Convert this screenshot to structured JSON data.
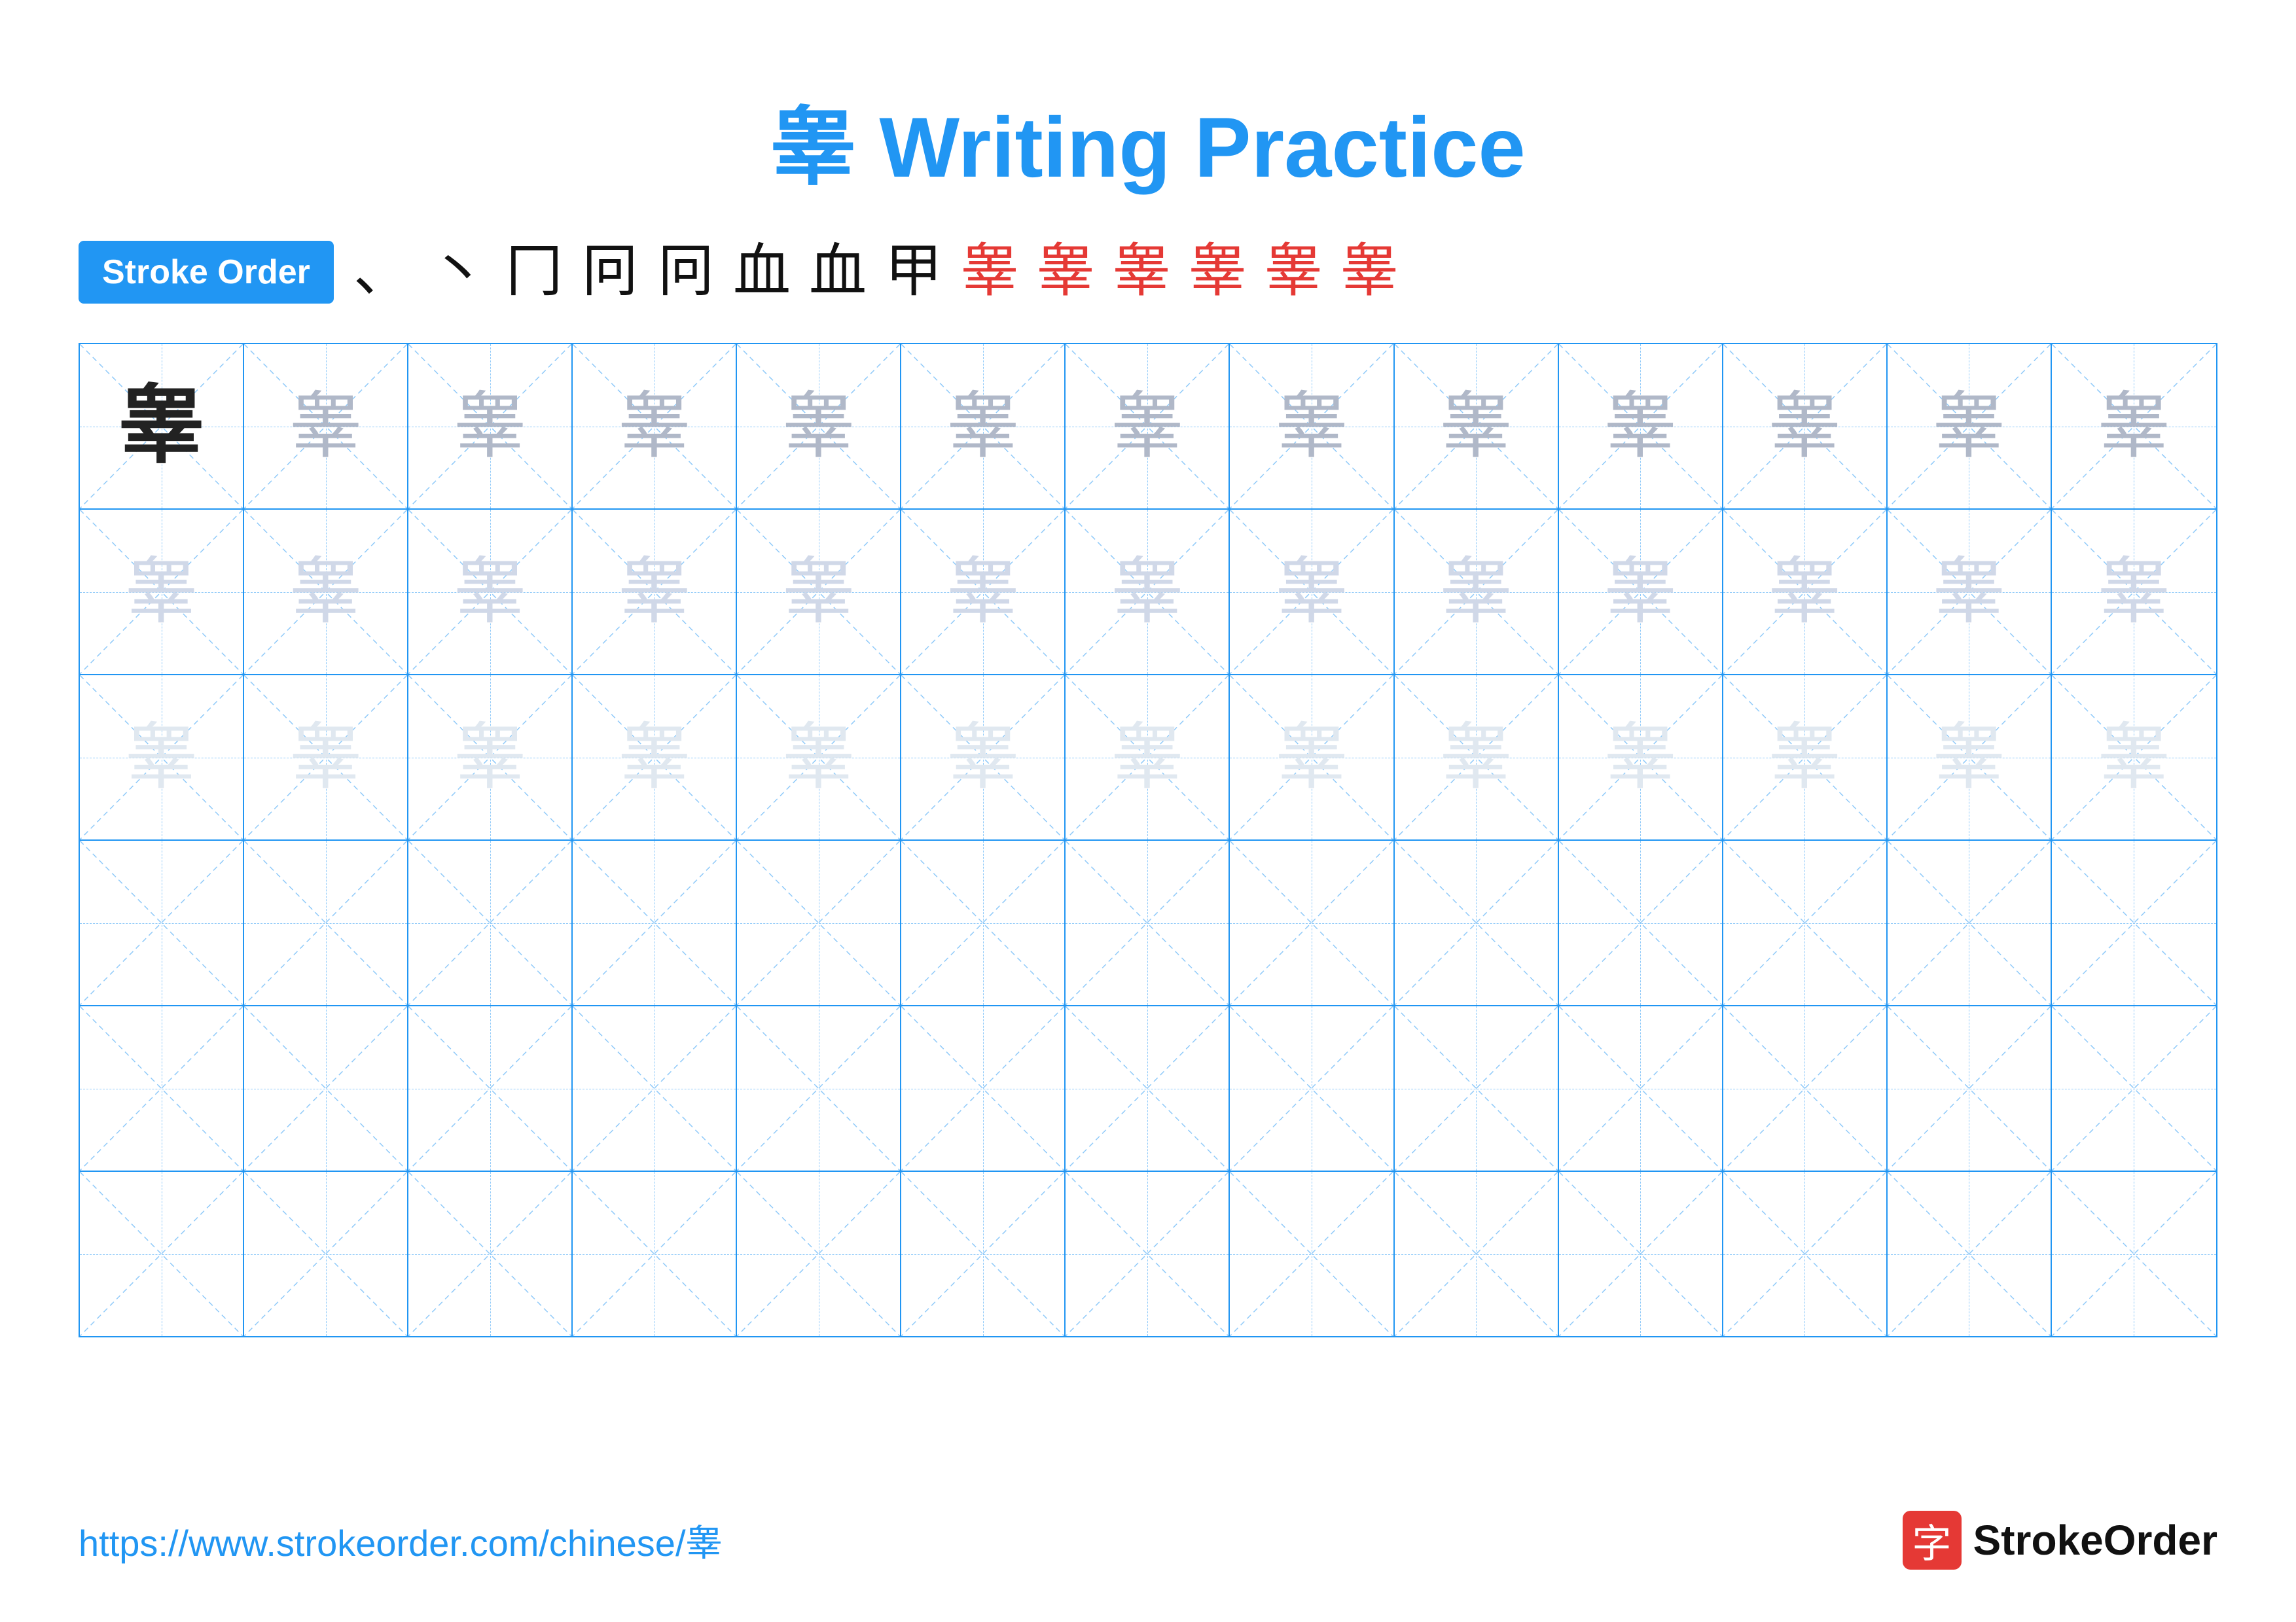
{
  "title": {
    "char": "睾",
    "label": "Writing Practice",
    "full": "睾 Writing Practice"
  },
  "stroke_order": {
    "badge_label": "Stroke Order",
    "strokes": [
      "、",
      "丶",
      "冂",
      "冋",
      "冋",
      "血",
      "血",
      "甲",
      "睾",
      "睾",
      "睾",
      "睾",
      "睾",
      "睾"
    ]
  },
  "grid": {
    "rows": 6,
    "cols": 13,
    "char": "睾"
  },
  "footer": {
    "url": "https://www.strokeorder.com/chinese/睾",
    "logo_char": "字",
    "logo_text": "StrokeOrder"
  }
}
